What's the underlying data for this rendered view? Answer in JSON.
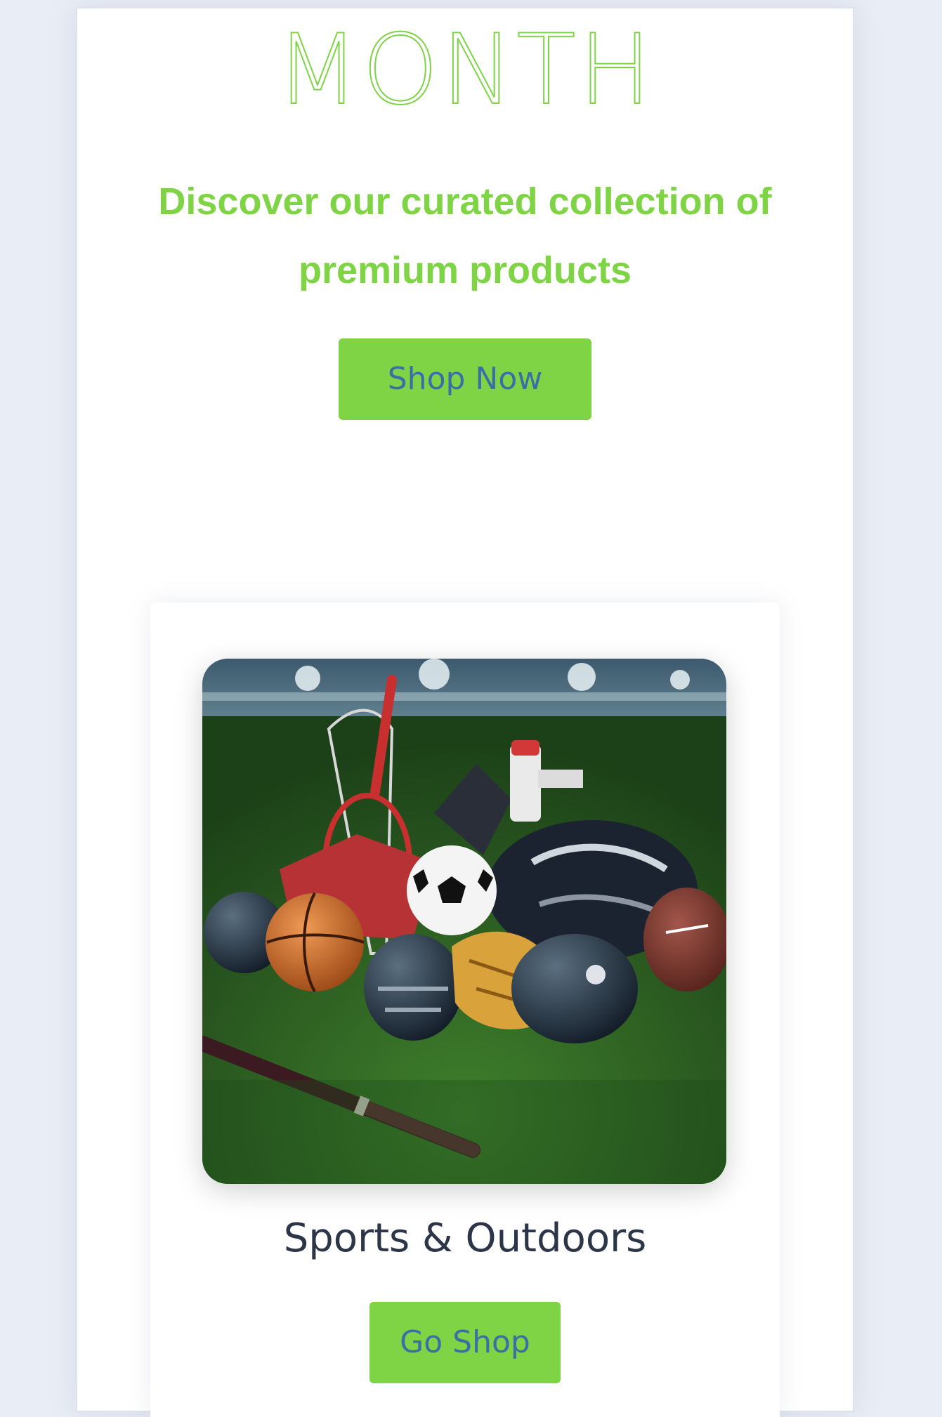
{
  "hero": {
    "headline": "MONTH",
    "subtitle_lines": [
      "Discover our curated collection of",
      "premium products"
    ],
    "cta_label": "Shop Now"
  },
  "category_card": {
    "image_alt": "Sports & Outdoors",
    "title": "Sports & Outdoors",
    "cta_label": "Go Shop"
  },
  "colors": {
    "accent_green": "#7ed444",
    "button_text_blue": "#3a6ea5",
    "page_background": "#e9edf5",
    "card_title": "#2c3648"
  }
}
